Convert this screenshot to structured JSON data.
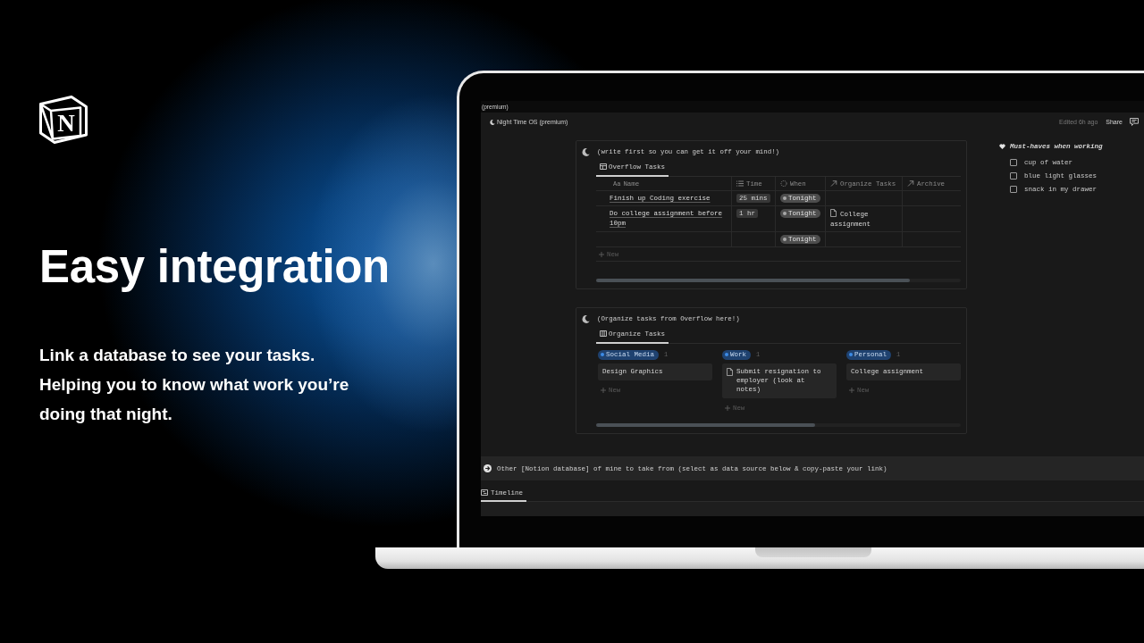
{
  "logo": {
    "letter": "N"
  },
  "hero": {
    "title": "Easy integration",
    "body": "Link a database to see your tasks. Helping you to know what work you’re doing that night."
  },
  "app": {
    "window_title": "(premium)",
    "topbar": {
      "page_title": "Night Time OS (premium)",
      "edited": "Edited 6h ago",
      "share": "Share"
    },
    "blocks": [
      {
        "kind": "table",
        "caption": "(write first so you can get it off your mind!)",
        "views": [
          {
            "kind": "table",
            "label": "Overflow Tasks",
            "selected": true
          }
        ],
        "columns": [
          {
            "kind": "title",
            "icon_text": "Aa",
            "label": "Name"
          },
          {
            "kind": "text",
            "label": "Time"
          },
          {
            "kind": "status",
            "label": "When"
          },
          {
            "kind": "relation",
            "label": "Organize Tasks"
          },
          {
            "kind": "relation",
            "label": "Archive"
          }
        ],
        "rows": [
          {
            "cells": [
              "Finish up Coding exercise",
              "25 mins",
              "Tonight",
              null,
              null
            ]
          },
          {
            "cells": [
              "Do college assignment before 10pm",
              "1 hr",
              "Tonight",
              "College assignment",
              null
            ]
          },
          {
            "cells": [
              null,
              null,
              "Tonight",
              null,
              null
            ]
          }
        ],
        "new_label": "New"
      },
      {
        "kind": "board",
        "caption": "(Organize tasks from Overflow here!)",
        "views": [
          {
            "kind": "board",
            "label": "Organize Tasks",
            "selected": true
          }
        ],
        "groups": [
          {
            "label": "Social Media",
            "count": "1",
            "cards": [
              {
                "title": "Design Graphics",
                "page_icon": false
              }
            ],
            "new_label": "New"
          },
          {
            "label": "Work",
            "count": "1",
            "cards": [
              {
                "title": "Submit resignation to employer (look at notes)",
                "page_icon": true
              }
            ],
            "new_label": "New"
          },
          {
            "label": "Personal",
            "count": "1",
            "cards": [
              {
                "title": "College assignment",
                "page_icon": false
              }
            ],
            "new_label": "New"
          }
        ]
      }
    ],
    "checklist": {
      "title": "Must-haves when working",
      "items": [
        {
          "label": "cup of water",
          "checked": false
        },
        {
          "label": "blue light glasses",
          "checked": false
        },
        {
          "label": "snack in my drawer",
          "checked": false
        }
      ]
    },
    "callout": {
      "text": "Other [Notion database] of mine to take from (select as data source below & copy-paste your link)"
    },
    "timeline_views": [
      {
        "kind": "timeline",
        "label": "Timeline",
        "selected": true
      }
    ]
  }
}
